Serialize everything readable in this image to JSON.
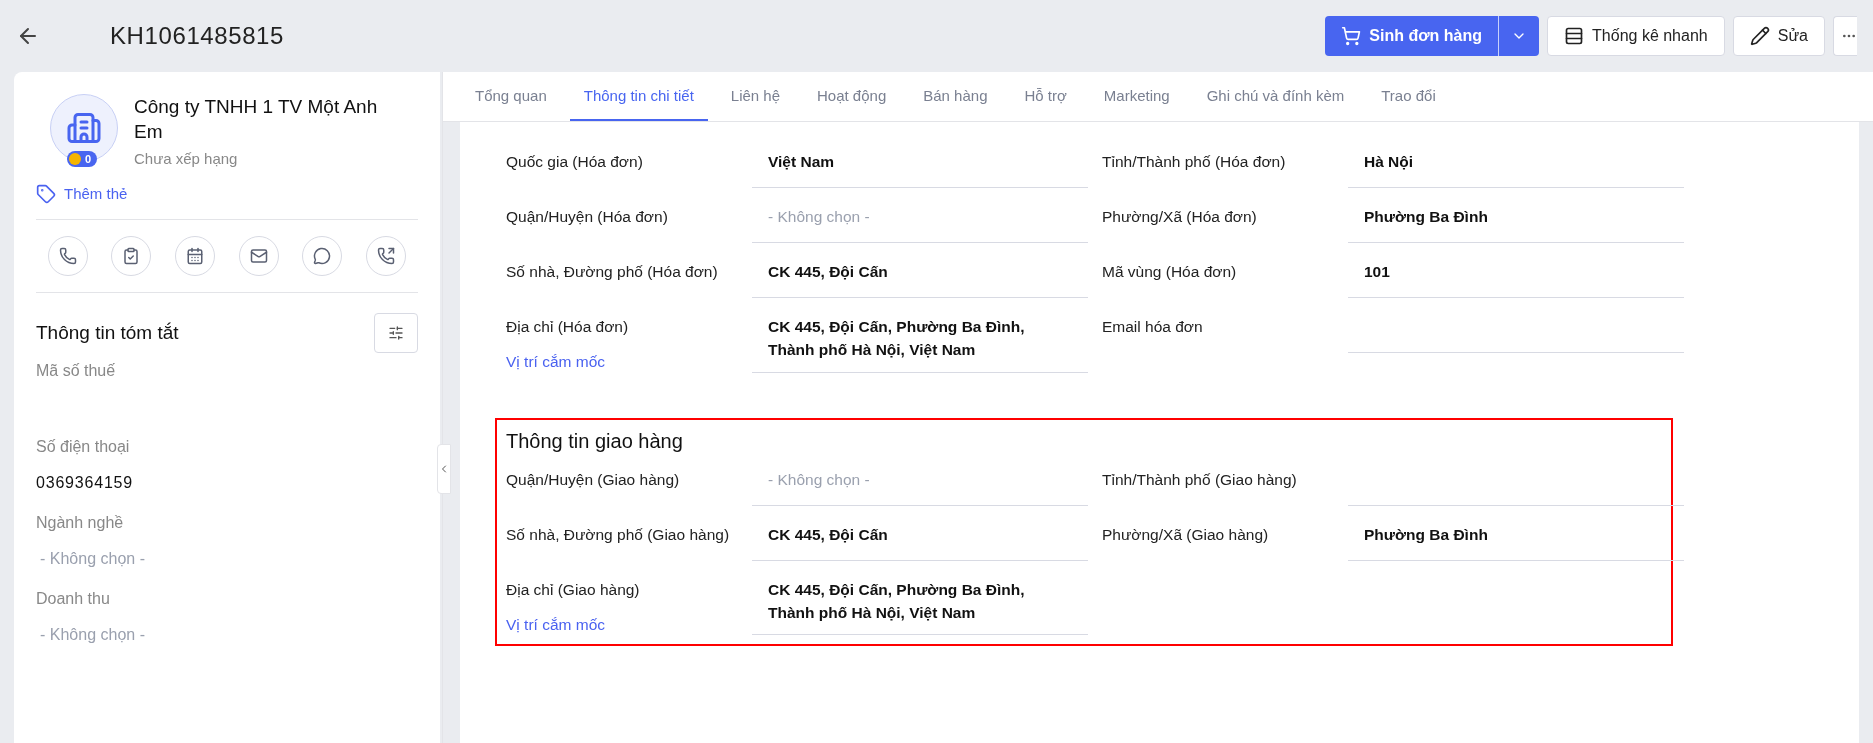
{
  "header": {
    "title": "KH1061485815",
    "primary_button": "Sinh đơn hàng",
    "buttons": [
      "Thống kê nhanh",
      "Sửa"
    ]
  },
  "profile": {
    "name": "Công ty TNHH 1 TV Một Anh Em",
    "points": "0",
    "rank": "Chưa xếp hạng",
    "tag_link": "Thêm thẻ"
  },
  "summary": {
    "title": "Thông tin tóm tắt",
    "fields": [
      {
        "label": "Mã số thuế"
      },
      {
        "label": "Số điện thoại",
        "value": "0369364159",
        "kind": "value"
      },
      {
        "label": "Ngành nghề",
        "value": "- Không chọn -",
        "kind": "empty"
      },
      {
        "label": "Doanh thu",
        "value": "- Không chọn -",
        "kind": "empty"
      }
    ]
  },
  "tabs": [
    {
      "label": "Tổng quan",
      "selected": false
    },
    {
      "label": "Thông tin chi tiết",
      "selected": true
    },
    {
      "label": "Liên hệ",
      "selected": false
    },
    {
      "label": "Hoạt động",
      "selected": false
    },
    {
      "label": "Bán hàng",
      "selected": false
    },
    {
      "label": "Hỗ trợ",
      "selected": false
    },
    {
      "label": "Marketing",
      "selected": false
    },
    {
      "label": "Ghi chú và đính kèm",
      "selected": false
    },
    {
      "label": "Trao đổi",
      "selected": false
    }
  ],
  "sections": [
    {
      "highlighted": false,
      "fields": [
        {
          "label": "Quốc gia (Hóa đơn)",
          "value": "Việt Nam",
          "kind": "value"
        },
        {
          "label": "Tỉnh/Thành phố (Hóa đơn)",
          "value": "Hà Nội",
          "kind": "value"
        },
        {
          "label": "Quận/Huyện (Hóa đơn)",
          "value": "- Không chọn -",
          "kind": "empty"
        },
        {
          "label": "Phường/Xã (Hóa đơn)",
          "value": "Phường Ba Đình",
          "kind": "value"
        },
        {
          "label": "Số nhà, Đường phố (Hóa đơn)",
          "value": "CK 445, Đội Cấn",
          "kind": "value"
        },
        {
          "label": "Mã vùng (Hóa đơn)",
          "value": "101",
          "kind": "value"
        },
        {
          "label": "Địa chỉ (Hóa đơn)",
          "link": "Vị trí cắm mốc",
          "value": "CK 445, Đội Cấn, Phường Ba Đình, Thành phố Hà Nội, Việt Nam",
          "kind": "value"
        },
        {
          "label": "Email hóa đơn"
        }
      ]
    },
    {
      "title": "Thông tin giao hàng",
      "highlighted": true,
      "fields": [
        {
          "label": "Quận/Huyện (Giao hàng)",
          "value": "- Không chọn -",
          "kind": "empty"
        },
        {
          "label": "Tỉnh/Thành phố (Giao hàng)"
        },
        {
          "label": "Số nhà, Đường phố (Giao hàng)",
          "value": "CK 445, Đội Cấn",
          "kind": "value"
        },
        {
          "label": "Phường/Xã (Giao hàng)",
          "value": "Phường Ba Đình",
          "kind": "value"
        },
        {
          "label": "Địa chỉ (Giao hàng)",
          "link": "Vị trí cắm mốc",
          "value": "CK 445, Đội Cấn, Phường Ba Đình, Thành phố Hà Nội, Việt Nam",
          "kind": "value"
        }
      ]
    }
  ]
}
